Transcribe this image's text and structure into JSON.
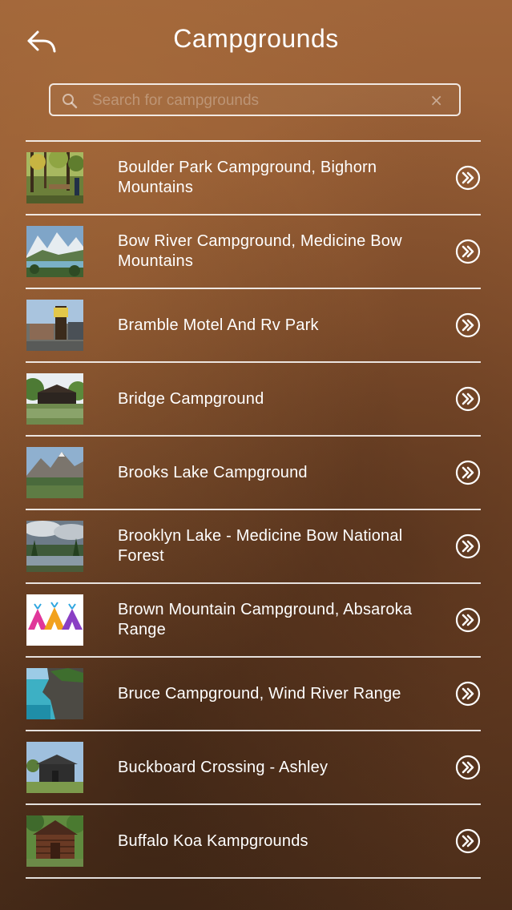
{
  "header": {
    "title": "Campgrounds",
    "back_icon": "back-arrow-icon"
  },
  "search": {
    "placeholder": "Search for campgrounds",
    "value": "",
    "search_icon": "magnifier-icon",
    "clear_icon": "×"
  },
  "items": [
    {
      "label": "Boulder Park Campground, Bighorn Mountains",
      "thumb": "forest-campsite"
    },
    {
      "label": "Bow River Campground, Medicine Bow Mountains",
      "thumb": "mountain-lake"
    },
    {
      "label": "Bramble Motel And Rv Park",
      "thumb": "motel-sign"
    },
    {
      "label": "Bridge Campground",
      "thumb": "covered-bridge"
    },
    {
      "label": "Brooks Lake Campground",
      "thumb": "mountain-peak-lake"
    },
    {
      "label": "Brooklyn Lake - Medicine Bow National Forest",
      "thumb": "cloudy-lake"
    },
    {
      "label": "Brown Mountain Campground, Absaroka Range",
      "thumb": "teepee-logo"
    },
    {
      "label": "Bruce Campground, Wind River Range",
      "thumb": "cliff-water"
    },
    {
      "label": "Buckboard Crossing - Ashley",
      "thumb": "cabin-building"
    },
    {
      "label": "Buffalo Koa Kampgrounds",
      "thumb": "log-cabin"
    }
  ],
  "colors": {
    "background": "#8a5630",
    "text": "#ffffff",
    "divider": "#ffffff"
  }
}
